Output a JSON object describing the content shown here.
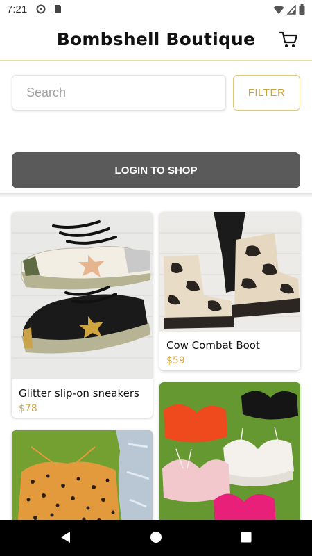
{
  "status_bar": {
    "time": "7:21"
  },
  "header": {
    "title": "Bombshell Boutique"
  },
  "search": {
    "placeholder": "Search",
    "filter_label": "FILTER"
  },
  "login": {
    "label": "LOGIN TO SHOP"
  },
  "products": [
    {
      "name": "Glitter slip-on sneakers",
      "price": "$78"
    },
    {
      "name": "Cow Combat Boot",
      "price": "$59"
    },
    {
      "name": "",
      "price": ""
    },
    {
      "name": "",
      "price": ""
    }
  ],
  "colors": {
    "accent": "#c8a43a",
    "price": "#d4a84a",
    "login_button": "#5a5a5a",
    "header_border": "#e6d7a6"
  },
  "icons": [
    "wifi-icon",
    "cell-signal-icon",
    "battery-icon",
    "cart-icon",
    "back-icon",
    "home-icon",
    "recents-icon"
  ]
}
